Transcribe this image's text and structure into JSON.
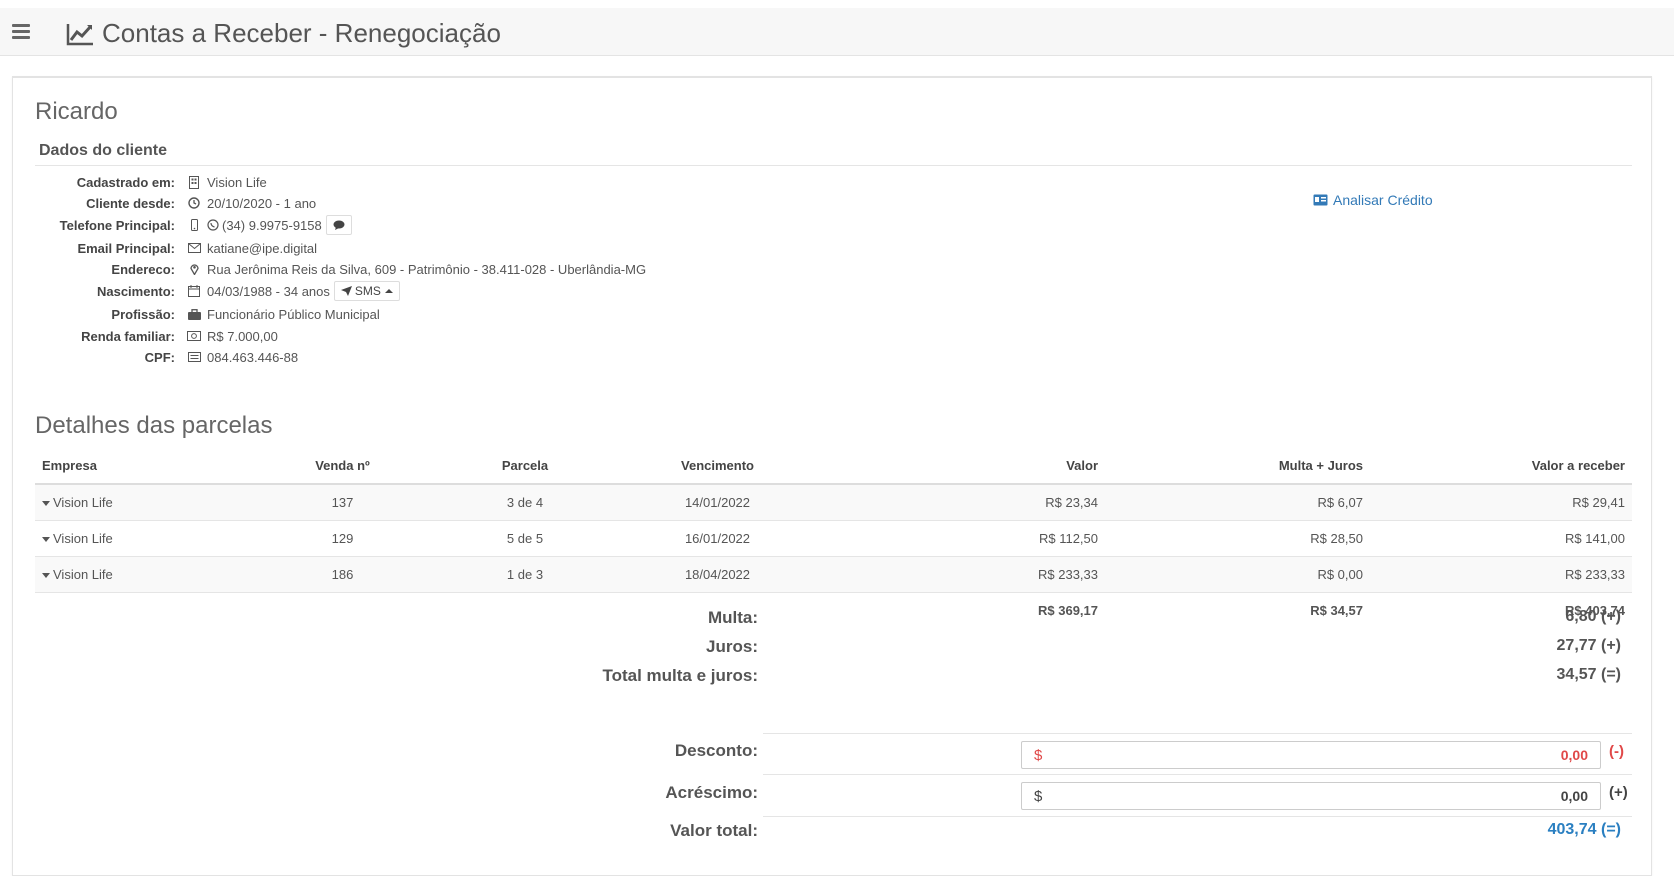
{
  "header": {
    "title": "Contas a Receber - Renegociação"
  },
  "client": {
    "name": "Ricardo",
    "section_title": "Dados do cliente",
    "fields": [
      {
        "label": "Cadastrado em:",
        "icon": "building-icon",
        "value": "Vision Life"
      },
      {
        "label": "Cliente desde:",
        "icon": "clock-icon",
        "value": "20/10/2020 - 1 ano"
      },
      {
        "label": "Telefone Principal:",
        "icon": "mobile-icon",
        "value": "(34) 9.9975-9158"
      },
      {
        "label": "Email Principal:",
        "icon": "envelope-icon",
        "value": "katiane@ipe.digital"
      },
      {
        "label": "Endereco:",
        "icon": "map-marker-icon",
        "value": "Rua Jerônima Reis da Silva, 609 - Patrimônio - 38.411-028 - Uberlândia-MG"
      },
      {
        "label": "Nascimento:",
        "icon": "calendar-icon",
        "value": "04/03/1988 - 34 anos"
      },
      {
        "label": "Profissão:",
        "icon": "briefcase-icon",
        "value": "Funcionário Público Municipal"
      },
      {
        "label": "Renda familiar:",
        "icon": "money-icon",
        "value": "R$ 7.000,00"
      },
      {
        "label": "CPF:",
        "icon": "id-card-icon",
        "value": "084.463.446-88"
      }
    ],
    "sms_label": "SMS",
    "analisar_label": "Analisar Crédito"
  },
  "parcelas": {
    "title": "Detalhes das parcelas",
    "columns": [
      "Empresa",
      "Venda nº",
      "Parcela",
      "Vencimento",
      "Valor",
      "Multa + Juros",
      "Valor a receber"
    ],
    "rows": [
      {
        "empresa": "Vision Life",
        "venda": "137",
        "parcela": "3 de 4",
        "vencimento": "14/01/2022",
        "valor": "R$ 23,34",
        "multa_juros": "R$ 6,07",
        "receber": "R$ 29,41"
      },
      {
        "empresa": "Vision Life",
        "venda": "129",
        "parcela": "5 de 5",
        "vencimento": "16/01/2022",
        "valor": "R$ 112,50",
        "multa_juros": "R$ 28,50",
        "receber": "R$ 141,00"
      },
      {
        "empresa": "Vision Life",
        "venda": "186",
        "parcela": "1 de 3",
        "vencimento": "18/04/2022",
        "valor": "R$ 233,33",
        "multa_juros": "R$ 0,00",
        "receber": "R$ 233,33"
      }
    ],
    "totals": {
      "valor": "R$ 369,17",
      "multa_juros": "R$ 34,57",
      "receber": "R$ 403,74"
    }
  },
  "summary": {
    "multa_label": "Multa:",
    "multa_value": "6,80 (+)",
    "juros_label": "Juros:",
    "juros_value": "27,77 (+)",
    "total_mj_label": "Total multa e juros:",
    "total_mj_value": "34,57 (=)",
    "desconto_label": "Desconto:",
    "desconto_currency": "$",
    "desconto_value": "0,00",
    "desconto_sign": "(-)",
    "acrescimo_label": "Acréscimo:",
    "acrescimo_currency": "$",
    "acrescimo_value": "0,00",
    "acrescimo_sign": "(+)",
    "valor_total_label": "Valor total:",
    "valor_total_value": "403,74 (=)"
  },
  "colors": {
    "link": "#337ab7",
    "discount_red": "#e04848",
    "total_blue": "#2a7fc1"
  }
}
